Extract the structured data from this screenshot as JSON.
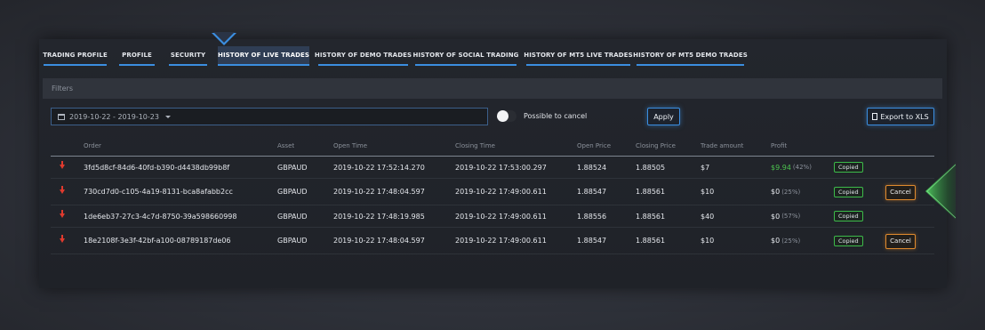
{
  "tabs": [
    {
      "label": "TRADING PROFILE",
      "active": false
    },
    {
      "label": "PROFILE",
      "active": false
    },
    {
      "label": "SECURITY",
      "active": false
    },
    {
      "label": "HISTORY OF LIVE TRADES",
      "active": true
    },
    {
      "label": "HISTORY OF DEMO TRADES",
      "active": false
    },
    {
      "label": "HISTORY OF SOCIAL TRADING",
      "active": false
    },
    {
      "label": "HISTORY OF MT5 LIVE TRADES",
      "active": false
    },
    {
      "label": "HISTORY OF MT5 DEMO TRADES",
      "active": false
    }
  ],
  "filters": {
    "title": "Filters",
    "date_range": "2019-10-22 - 2019-10-23",
    "possible_to_cancel_label": "Possible to cancel",
    "possible_to_cancel_on": false,
    "apply_label": "Apply",
    "export_label": "Export to XLS"
  },
  "table": {
    "columns": [
      "Order",
      "Asset",
      "Open Time",
      "Closing Time",
      "Open Price",
      "Closing Price",
      "Trade amount",
      "Profit"
    ],
    "rows": [
      {
        "direction": "down",
        "order": "3fd5d8cf-84d6-40fd-b390-d4438db99b8f",
        "asset": "GBPAUD",
        "open_time": "2019-10-22 17:52:14.270",
        "closing_time": "2019-10-22 17:53:00.297",
        "open_price": "1.88524",
        "closing_price": "1.88505",
        "trade_amount": "$7",
        "profit": "$9.94",
        "profit_pct": "(42%)",
        "status": "Copied",
        "cancel_label": ""
      },
      {
        "direction": "down",
        "order": "730cd7d0-c105-4a19-8131-bca8afabb2cc",
        "asset": "GBPAUD",
        "open_time": "2019-10-22 17:48:04.597",
        "closing_time": "2019-10-22 17:49:00.611",
        "open_price": "1.88547",
        "closing_price": "1.88561",
        "trade_amount": "$10",
        "profit": "$0",
        "profit_pct": "(25%)",
        "status": "Copied",
        "cancel_label": "Cancel"
      },
      {
        "direction": "down",
        "order": "1de6eb37-27c3-4c7d-8750-39a598660998",
        "asset": "GBPAUD",
        "open_time": "2019-10-22 17:48:19.985",
        "closing_time": "2019-10-22 17:49:00.611",
        "open_price": "1.88556",
        "closing_price": "1.88561",
        "trade_amount": "$40",
        "profit": "$0",
        "profit_pct": "(57%)",
        "status": "Copied",
        "cancel_label": ""
      },
      {
        "direction": "down",
        "order": "18e2108f-3e3f-42bf-a100-08789187de06",
        "asset": "GBPAUD",
        "open_time": "2019-10-22 17:48:04.597",
        "closing_time": "2019-10-22 17:49:00.611",
        "open_price": "1.88547",
        "closing_price": "1.88561",
        "trade_amount": "$10",
        "profit": "$0",
        "profit_pct": "(25%)",
        "status": "Copied",
        "cancel_label": "Cancel"
      }
    ]
  },
  "colors": {
    "accent": "#3b8ee0",
    "profit_positive": "#4cc24e",
    "sell_arrow": "#e03a2e",
    "copied_badge": "#3dbb4a",
    "cancel_button": "#e08a2e",
    "pointer_arrow": "#2fbf3f"
  }
}
